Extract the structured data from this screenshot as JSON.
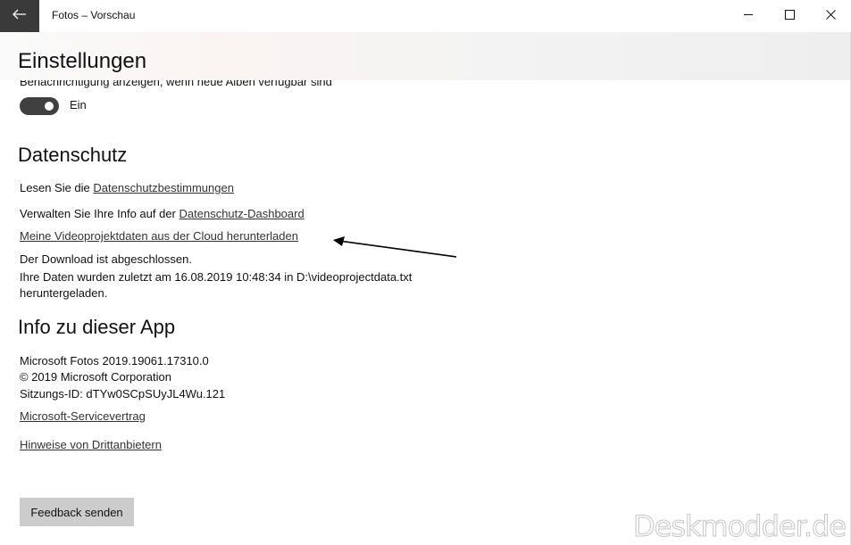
{
  "window": {
    "title": "Fotos – Vorschau",
    "back_icon": "arrow-left-icon",
    "controls": [
      "minimize-icon",
      "maximize-icon",
      "close-icon"
    ]
  },
  "header": {
    "title": "Einstellungen"
  },
  "notifications": {
    "clipped_text": "Benachrichtigung anzeigen, wenn neue Alben verfügbar sind",
    "toggle_state": "on",
    "toggle_label": "Ein"
  },
  "privacy": {
    "title": "Datenschutz",
    "read_prefix": "Lesen Sie die ",
    "read_link": "Datenschutzbestimmungen",
    "manage_prefix": "Verwalten Sie Ihre Info auf der ",
    "manage_link": "Datenschutz-Dashboard",
    "download_link": "Meine Videoprojektdaten aus der Cloud herunterladen",
    "status_line1": "Der Download ist abgeschlossen.",
    "status_line2": "Ihre Daten wurden zuletzt am 16.08.2019 10:48:34 in D:\\videoprojectdata.txt",
    "status_line3": "heruntergeladen."
  },
  "about": {
    "title": "Info zu dieser App",
    "version": "Microsoft Fotos 2019.19061.17310.0",
    "copyright": "© 2019 Microsoft Corporation",
    "session": "Sitzungs-ID: dTYw0SCpSUyJL4Wu.121",
    "service_link": "Microsoft-Servicevertrag",
    "third_party_link": "Hinweise von Drittanbietern"
  },
  "feedback": {
    "button_label": "Feedback senden"
  },
  "watermark": "Deskmodder.de",
  "colors": {
    "toggle_on": "#404040",
    "button_bg": "#cccccc",
    "back_button_bg": "#3a3a3a"
  }
}
